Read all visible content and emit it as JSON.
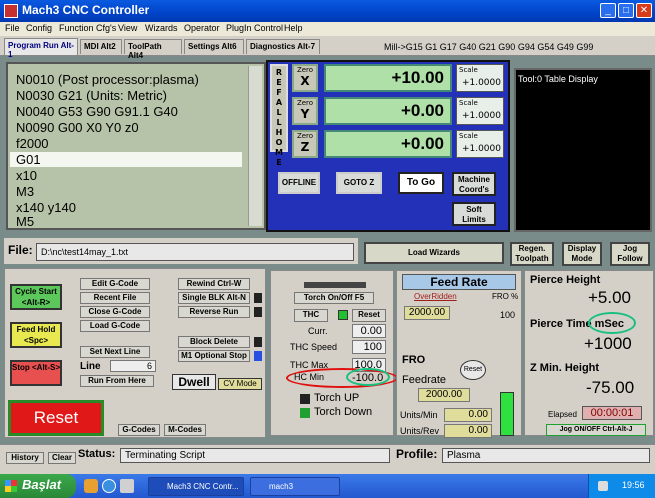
{
  "window": {
    "title": "Mach3 CNC Controller",
    "min": "_",
    "max": "□",
    "close": "✕"
  },
  "menu": [
    "File",
    "Config",
    "Function Cfg's",
    "View",
    "Wizards",
    "Operator",
    "PlugIn Control",
    "Help"
  ],
  "tabs": [
    "Program Run Alt-1",
    "MDI Alt2",
    "ToolPath Alt4",
    "Settings Alt6",
    "Diagnostics Alt-7"
  ],
  "modal_line": "Mill->G15  G1 G17 G40 G21 G90 G94 G54 G49 G99",
  "gcode": {
    "lines": [
      "N0010 (Post processor:plasma)",
      "N0030 G21 (Units: Metric)",
      "N0040 G53 G90 G91.1 G40",
      "N0090 G00 X0 Y0 z0",
      "f2000",
      "G01",
      "x10",
      "M3",
      "x140 y140",
      "M5"
    ],
    "selected_index": 5
  },
  "dro": {
    "ref_all_home": "REF ALL HOME",
    "axes": [
      {
        "zero_label": "Zero",
        "axis": "X",
        "value": "+10.00",
        "scale_label": "Scale",
        "scale": "+1.0000"
      },
      {
        "zero_label": "Zero",
        "axis": "Y",
        "value": "+0.00",
        "scale_label": "Scale",
        "scale": "+1.0000"
      },
      {
        "zero_label": "Zero",
        "axis": "Z",
        "value": "+0.00",
        "scale_label": "Scale",
        "scale": "+1.0000"
      }
    ],
    "offline": "OFFLINE",
    "goto_z": "GOTO Z",
    "to_go": "To Go",
    "machine_coords": "Machine Coord's",
    "soft_limits": "Soft Limits"
  },
  "toolpath": {
    "title": "Tool:0   Table Display"
  },
  "file": {
    "label": "File:",
    "path": "D:\\nc\\test14may_1.txt"
  },
  "load_wizards": "Load Wizards",
  "regen_toolpath": "Regen. Toolpath",
  "display_mode": "Display Mode",
  "jog_follow": "Jog Follow",
  "controls": {
    "cycle_start": "Cycle Start <Alt-R>",
    "feed_hold": "Feed Hold <Spc>",
    "stop": "Stop <Alt-S>",
    "edit_gcode": "Edit G-Code",
    "recent_file": "Recent File",
    "close_gcode": "Close G-Code",
    "load_gcode": "Load G-Code",
    "set_next_line": "Set Next Line",
    "line_label": "Line",
    "line_value": "6",
    "run_from_here": "Run From Here",
    "rewind": "Rewind Ctrl-W",
    "single_blk": "Single BLK Alt-N",
    "reverse_run": "Reverse Run",
    "block_delete": "Block Delete",
    "m1_optional": "M1 Optional Stop",
    "dwell": "Dwell",
    "cv_mode": "CV Mode",
    "reset": "Reset",
    "gcodes": "G-Codes",
    "mcodes": "M-Codes"
  },
  "thc": {
    "torch_onoff": "Torch On/Off F5",
    "thc": "THC",
    "reset": "Reset",
    "curr_label": "Curr.",
    "curr_value": "0.00",
    "speed_label": "THC Speed",
    "speed_value": "100",
    "max_label": "THC Max",
    "max_value": "100.0",
    "min_label": "HC Min",
    "min_value": "-100.0",
    "torch_up": "Torch UP",
    "torch_down": "Torch Down"
  },
  "feed": {
    "title": "Feed Rate",
    "overridden": "OverRidden",
    "fro_pct": "FRO %",
    "value": "2000.00",
    "pct": "100",
    "fro": "FRO",
    "reset": "Reset",
    "feedrate_label": "Feedrate",
    "feedrate_value": "2000.00",
    "units_min_label": "Units/Min",
    "units_min_value": "0.00",
    "units_rev_label": "Units/Rev",
    "units_rev_value": "0.00"
  },
  "pierce": {
    "height_label": "Pierce Height",
    "height_value": "+5.00",
    "time_label": "Pierce Time mSec",
    "time_value": "+1000",
    "zmin_label": "Z Min. Height",
    "zmin_value": "-75.00",
    "elapsed_label": "Elapsed",
    "elapsed_value": "00:00:01",
    "jog_onoff": "Jog ON/OFF Ctrl-Alt-J"
  },
  "statusbar": {
    "history": "History",
    "clear": "Clear",
    "status_label": "Status:",
    "status_value": "Terminating Script",
    "profile_label": "Profile:",
    "profile_value": "Plasma"
  },
  "taskbar": {
    "start": "Başlat",
    "task1": "Mach3 CNC Contr...",
    "task2": "mach3",
    "time": "19:56"
  }
}
